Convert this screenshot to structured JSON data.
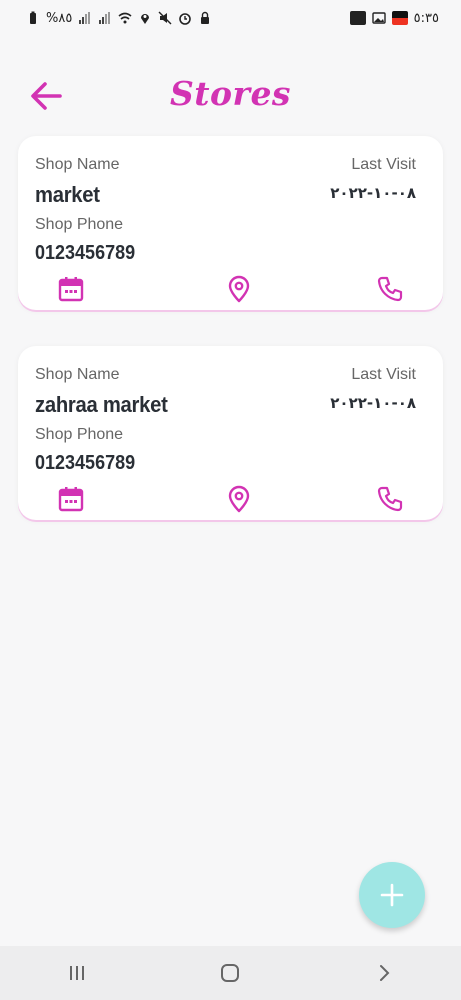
{
  "status_bar": {
    "battery_text": "%٨٥",
    "time": "٥:٣٥",
    "icons_left": [
      "battery-icon",
      "signal-icon",
      "signal-icon",
      "wifi-icon",
      "location-icon",
      "mute-icon",
      "alarm-icon",
      "lock-icon"
    ],
    "icons_right": [
      "app-badge-icon",
      "gallery-icon",
      "app-badge-icon"
    ]
  },
  "appbar": {
    "title": "Stores",
    "back_icon": "arrow-left-icon"
  },
  "stores": [
    {
      "shop_name_label": "Shop Name",
      "shop_name": "market",
      "shop_phone_label": "Shop Phone",
      "shop_phone": "0123456789",
      "last_visit_label": "Last Visit",
      "last_visit": "٠٨-١٠-٢٠٢٢"
    },
    {
      "shop_name_label": "Shop Name",
      "shop_name": "zahraa market",
      "shop_phone_label": "Shop Phone",
      "shop_phone": "0123456789",
      "last_visit_label": "Last Visit",
      "last_visit": "٠٨-١٠-٢٠٢٢"
    }
  ],
  "card_actions": [
    "calendar-icon",
    "location-pin-icon",
    "phone-icon"
  ],
  "fab": {
    "icon": "plus-icon"
  },
  "navigation_bar": [
    "recent-apps-icon",
    "home-icon",
    "back-chevron-icon"
  ],
  "colors": {
    "accent": "#d233b3",
    "fab": "#9fe6e4",
    "background": "#f7f7f8",
    "card": "#ffffff"
  }
}
